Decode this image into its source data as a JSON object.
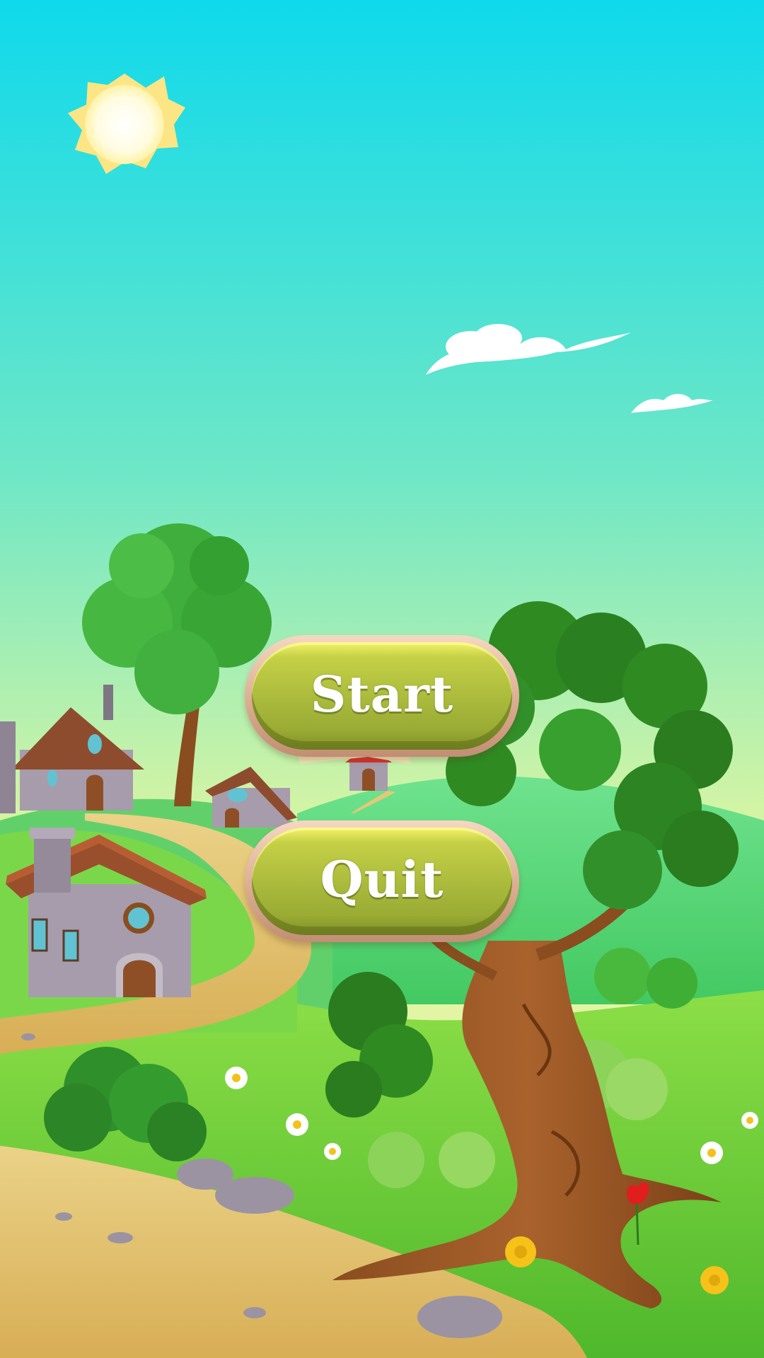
{
  "menu": {
    "start_label": "Start",
    "quit_label": "Quit"
  },
  "scene": {
    "sky_top_color": "#0fd9ec",
    "sky_bottom_color": "#f8f7a8",
    "grass_color": "#74d43a",
    "path_color": "#dcb45a",
    "button_color": "#a9b93c",
    "button_rim_color": "#e2b49a",
    "icons": [
      "sun-icon",
      "cloud-icon",
      "house-icon",
      "tree-icon",
      "windmill-icon",
      "flower-icon",
      "rock-icon",
      "bush-icon"
    ]
  }
}
